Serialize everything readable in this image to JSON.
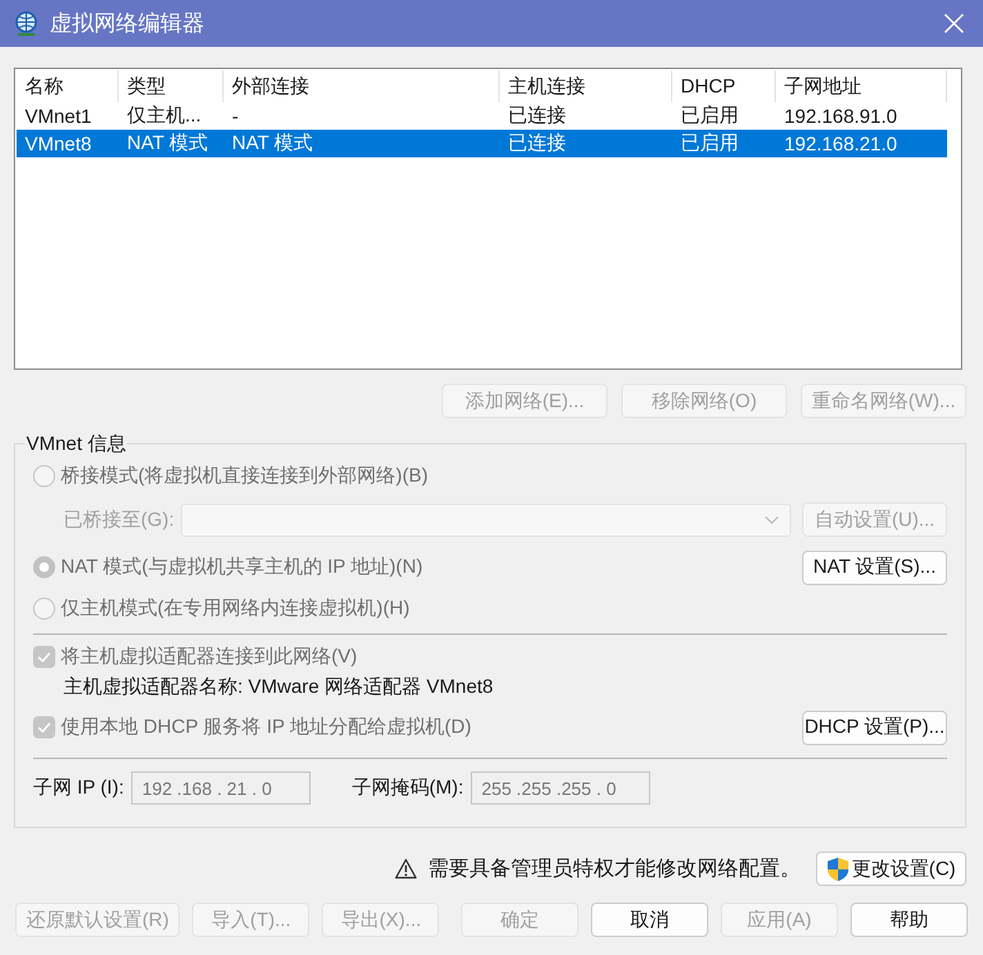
{
  "window": {
    "title": "虚拟网络编辑器"
  },
  "network_table": {
    "columns": [
      "名称",
      "类型",
      "外部连接",
      "主机连接",
      "DHCP",
      "子网地址"
    ],
    "rows": [
      {
        "selected": false,
        "cells": [
          "VMnet1",
          "仅主机...",
          "-",
          "已连接",
          "已启用",
          "192.168.91.0"
        ]
      },
      {
        "selected": true,
        "cells": [
          "VMnet8",
          "NAT 模式",
          "NAT 模式",
          "已连接",
          "已启用",
          "192.168.21.0"
        ]
      }
    ]
  },
  "list_buttons": [
    {
      "label": "添加网络(E)...",
      "disabled": true
    },
    {
      "label": "移除网络(O)",
      "disabled": true
    },
    {
      "label": "重命名网络(W)...",
      "disabled": true
    }
  ],
  "vmnet_info": {
    "title": "VMnet 信息",
    "modes": [
      {
        "label": "桥接模式(将虚拟机直接连接到外部网络)(B)",
        "selected": false,
        "disabled": true,
        "bridged_to": {
          "label": "已桥接至(G):",
          "dropdown_disabled": true,
          "button": {
            "label": "自动设置(U)...",
            "disabled": true
          }
        }
      },
      {
        "label": "NAT 模式(与虚拟机共享主机的 IP 地址)(N)",
        "selected": true,
        "disabled": true,
        "button": {
          "label": "NAT 设置(S)...",
          "disabled": false
        }
      },
      {
        "label": "仅主机模式(在专用网络内连接虚拟机)(H)",
        "selected": false,
        "disabled": true
      }
    ],
    "host_adapter": {
      "label": "将主机虚拟适配器连接到此网络(V)",
      "checked": true,
      "disabled": true,
      "name_text": "主机虚拟适配器名称: VMware 网络适配器 VMnet8"
    },
    "dhcp": {
      "label": "使用本地 DHCP 服务将 IP 地址分配给虚拟机(D)",
      "checked": true,
      "disabled": true,
      "button": {
        "label": "DHCP 设置(P)...",
        "disabled": false
      }
    },
    "subnet_ip": {
      "label": "子网 IP (I):",
      "value": "192 .168 . 21 . 0",
      "disabled": true
    },
    "subnet_mask": {
      "label": "子网掩码(M):",
      "value": "255 .255 .255 . 0",
      "disabled": true
    }
  },
  "notice": {
    "text": "需要具备管理员特权才能修改网络配置。",
    "button": {
      "label": "更改设置(C)",
      "disabled": false
    }
  },
  "footer": {
    "left_buttons": [
      {
        "label": "还原默认设置(R)",
        "disabled": true
      },
      {
        "label": "导入(T)...",
        "disabled": true
      },
      {
        "label": "导出(X)...",
        "disabled": true
      }
    ],
    "right_buttons": [
      {
        "label": "确定",
        "disabled": true
      },
      {
        "label": "取消",
        "disabled": false
      },
      {
        "label": "应用(A)",
        "disabled": true
      },
      {
        "label": "帮助",
        "disabled": false
      }
    ]
  }
}
